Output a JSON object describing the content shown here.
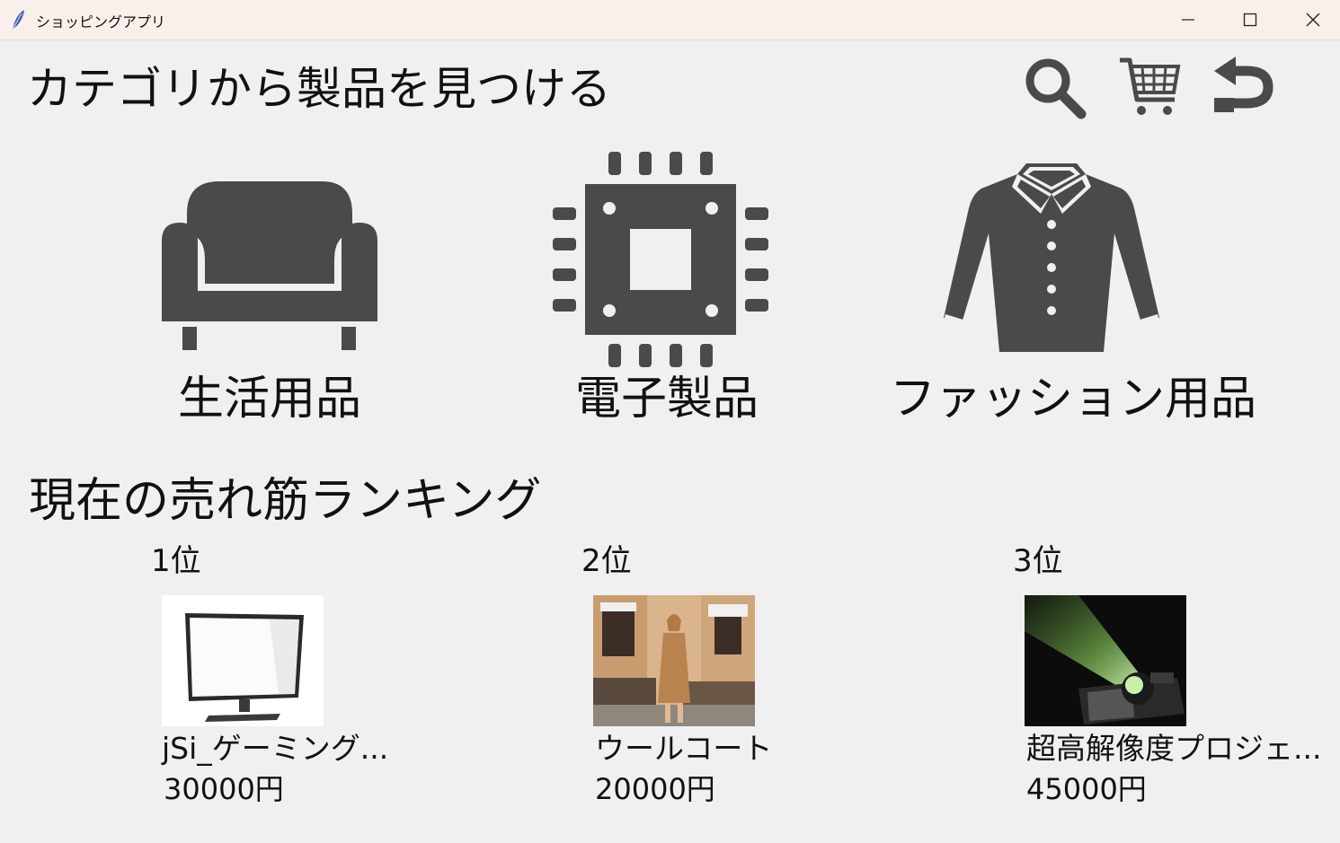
{
  "window": {
    "title": "ショッピングアプリ",
    "icons": [
      "feather-icon",
      "minimize-icon",
      "maximize-icon",
      "close-icon"
    ]
  },
  "header": {
    "title": "カテゴリから製品を見つける",
    "icons": [
      "search-icon",
      "cart-icon",
      "back-icon"
    ]
  },
  "categories": [
    {
      "label": "生活用品",
      "icon": "sofa-icon"
    },
    {
      "label": "電子製品",
      "icon": "chip-icon"
    },
    {
      "label": "ファッション用品",
      "icon": "shirt-icon"
    }
  ],
  "ranking": {
    "title": "現在の売れ筋ランキング",
    "items": [
      {
        "rank": "1位",
        "name": "jSi_ゲーミング...",
        "price": "30000円",
        "image": "monitor-image"
      },
      {
        "rank": "2位",
        "name": "ウールコート",
        "price": "20000円",
        "image": "wool-coat-image"
      },
      {
        "rank": "3位",
        "name": "超高解像度プロジェ...",
        "price": "45000円",
        "image": "projector-image"
      }
    ]
  },
  "colors": {
    "background": "#f0f0f0",
    "titlebar": "#f9f0ec",
    "icon": "#4a4a4a"
  }
}
